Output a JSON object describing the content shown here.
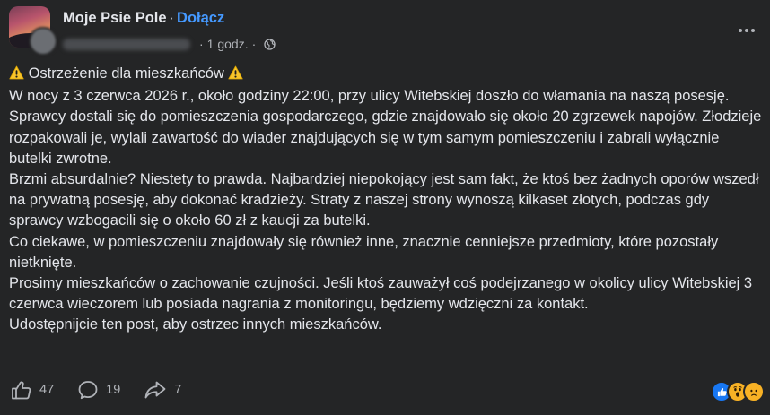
{
  "header": {
    "group_name": "Moje Psie Pole",
    "separator": "·",
    "join_label": "Dołącz",
    "time": "1 godz.",
    "time_separator": "·"
  },
  "post": {
    "title": "Ostrzeżenie dla mieszkańców",
    "paragraphs": [
      "W nocy z 3 czerwca 2026 r., około godziny 22:00, przy ulicy Witebskiej doszło do włamania na naszą posesję.",
      "Sprawcy dostali się do pomieszczenia gospodarczego, gdzie znajdowało się około 20 zgrzewek napojów. Złodzieje rozpakowali je, wylali zawartość do wiader znajdujących się w tym samym pomieszczeniu i zabrali wyłącznie butelki zwrotne.",
      "Brzmi absurdalnie? Niestety to prawda. Najbardziej niepokojący jest sam fakt, że ktoś bez żadnych oporów wszedł na prywatną posesję, aby dokonać kradzieży. Straty z naszej strony wynoszą kilkaset złotych, podczas gdy sprawcy wzbogacili się o około 60 zł z kaucji za butelki.",
      "Co ciekawe, w pomieszczeniu znajdowały się również inne, znacznie cenniejsze przedmioty, które pozostały nietknięte.",
      "Prosimy mieszkańców o zachowanie czujności. Jeśli ktoś zauważył coś podejrzanego w okolicy ulicy Witebskiej 3 czerwca wieczorem lub posiada nagrania z monitoringu, będziemy wdzięczni za kontakt.",
      "Udostępnijcie ten post, aby ostrzec innych mieszkańców."
    ]
  },
  "footer": {
    "likes": "47",
    "comments": "19",
    "shares": "7",
    "reactions": [
      "like",
      "wow",
      "sad"
    ]
  },
  "colors": {
    "background": "#242526",
    "text": "#e4e6eb",
    "secondary": "#b0b3b8",
    "link": "#4599ff",
    "like": "#1877f2",
    "wow": "#f7b125"
  }
}
